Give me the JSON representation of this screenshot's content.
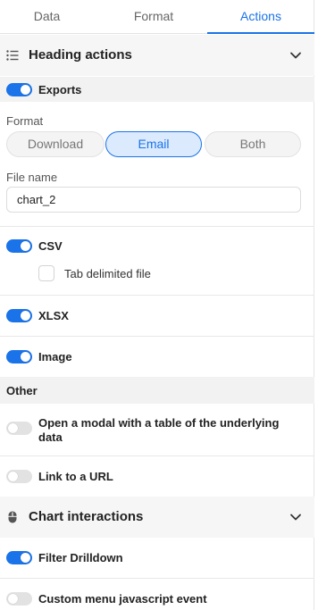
{
  "tabs": [
    {
      "label": "Data"
    },
    {
      "label": "Format"
    },
    {
      "label": "Actions"
    }
  ],
  "active_tab": "Actions",
  "accent_color": "#1a73e8",
  "heading_actions": {
    "title": "Heading actions",
    "icon": "list-icon",
    "exports": {
      "label": "Exports",
      "enabled": true
    },
    "format": {
      "label": "Format",
      "options": [
        "Download",
        "Email",
        "Both"
      ],
      "selected": "Email"
    },
    "file_name": {
      "label": "File name",
      "value": "chart_2"
    },
    "csv": {
      "label": "CSV",
      "enabled": true
    },
    "tab_delimited": {
      "label": "Tab delimited file",
      "checked": false
    },
    "xlsx": {
      "label": "XLSX",
      "enabled": true
    },
    "image": {
      "label": "Image",
      "enabled": true
    }
  },
  "other": {
    "title": "Other",
    "modal": {
      "label": "Open a modal with a table of the underlying data",
      "enabled": false
    },
    "link": {
      "label": "Link to a URL",
      "enabled": false
    }
  },
  "chart_interactions": {
    "title": "Chart interactions",
    "icon": "mouse-icon",
    "filter_drilldown": {
      "label": "Filter Drilldown",
      "enabled": true
    },
    "custom_menu": {
      "label": "Custom menu javascript event",
      "enabled": false
    }
  }
}
